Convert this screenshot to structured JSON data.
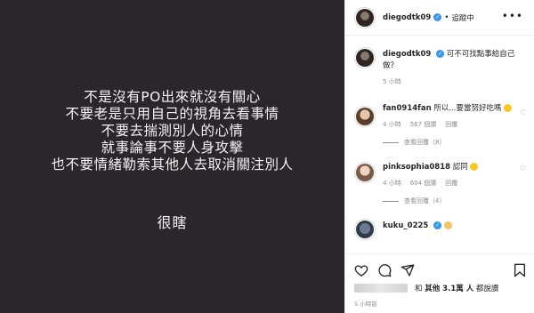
{
  "post": {
    "lines": [
      "不是沒有PO出來就沒有關心",
      "不要老是只用自己的視角去看事情",
      "不要去揣測別人的心情",
      "就事論事不要人身攻擊",
      "也不要情緒勒索其他人去取消關注別人"
    ],
    "footer": "很瞎"
  },
  "header": {
    "username": "diegodtk09",
    "verified": "✓",
    "separator": "•",
    "follow_status": "追蹤中",
    "more": "•••"
  },
  "caption": {
    "username": "diegodtk09",
    "text": "可不可找點事給自己做？",
    "time": "5 小時"
  },
  "comments": [
    {
      "username": "fan0914fan",
      "text": "所以...要當努好吃嗎",
      "time": "4 小時",
      "likes": "567 個讚",
      "reply": "回覆",
      "view_replies": "查看回覆（8）"
    },
    {
      "username": "pinksophia0818",
      "text": "認同",
      "time": "4 小時",
      "likes": "604 個讚",
      "reply": "回覆",
      "view_replies": "查看回覆（4）"
    },
    {
      "username": "kuku_0225",
      "text": ""
    }
  ],
  "likes_text": {
    "prefix": "和",
    "others": "其他 3.1萬 人",
    "suffix": "都說讚"
  },
  "timestamp": "5 小時前"
}
